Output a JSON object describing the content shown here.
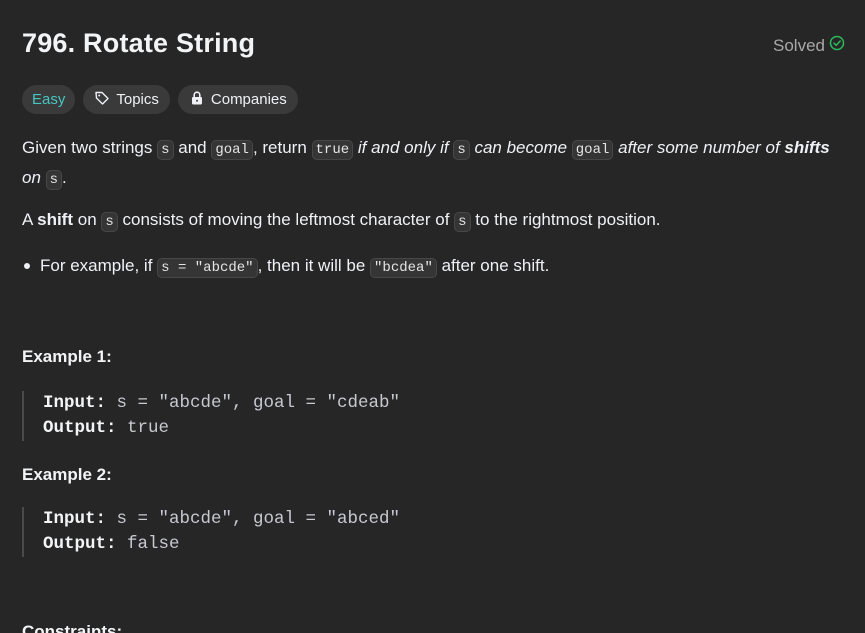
{
  "header": {
    "title": "796. Rotate String",
    "status": "Solved"
  },
  "tags": {
    "difficulty": "Easy",
    "topics": "Topics",
    "companies": "Companies"
  },
  "description": {
    "p1": {
      "t1": "Given two strings ",
      "c1": "s",
      "t2": " and ",
      "c2": "goal",
      "t3": ", return ",
      "c3": "true",
      "t4": " if and only if ",
      "c4": "s",
      "t5": " can become ",
      "c5": "goal",
      "t6": " after some number of ",
      "strong": "shifts",
      "t7": " on ",
      "c6": "s",
      "t8": "."
    },
    "p2": {
      "t1": "A ",
      "strong": "shift",
      "t2": " on ",
      "c1": "s",
      "t3": " consists of moving the leftmost character of ",
      "c2": "s",
      "t4": " to the rightmost position."
    },
    "bullet": {
      "t1": "For example, if ",
      "c1": "s = \"abcde\"",
      "t2": ", then it will be ",
      "c2": "\"bcdea\"",
      "t3": " after one shift."
    }
  },
  "examples": [
    {
      "title": "Example 1:",
      "input_label": "Input:",
      "input": " s = \"abcde\", goal = \"cdeab\"",
      "output_label": "Output:",
      "output": " true"
    },
    {
      "title": "Example 2:",
      "input_label": "Input:",
      "input": " s = \"abcde\", goal = \"abced\"",
      "output_label": "Output:",
      "output": " false"
    }
  ],
  "next_section": "Constraints:",
  "colors": {
    "background": "#262626",
    "easy": "#46c6c2",
    "solved_check": "#2cbb5d",
    "tag_bg": "#3a3a3a"
  }
}
